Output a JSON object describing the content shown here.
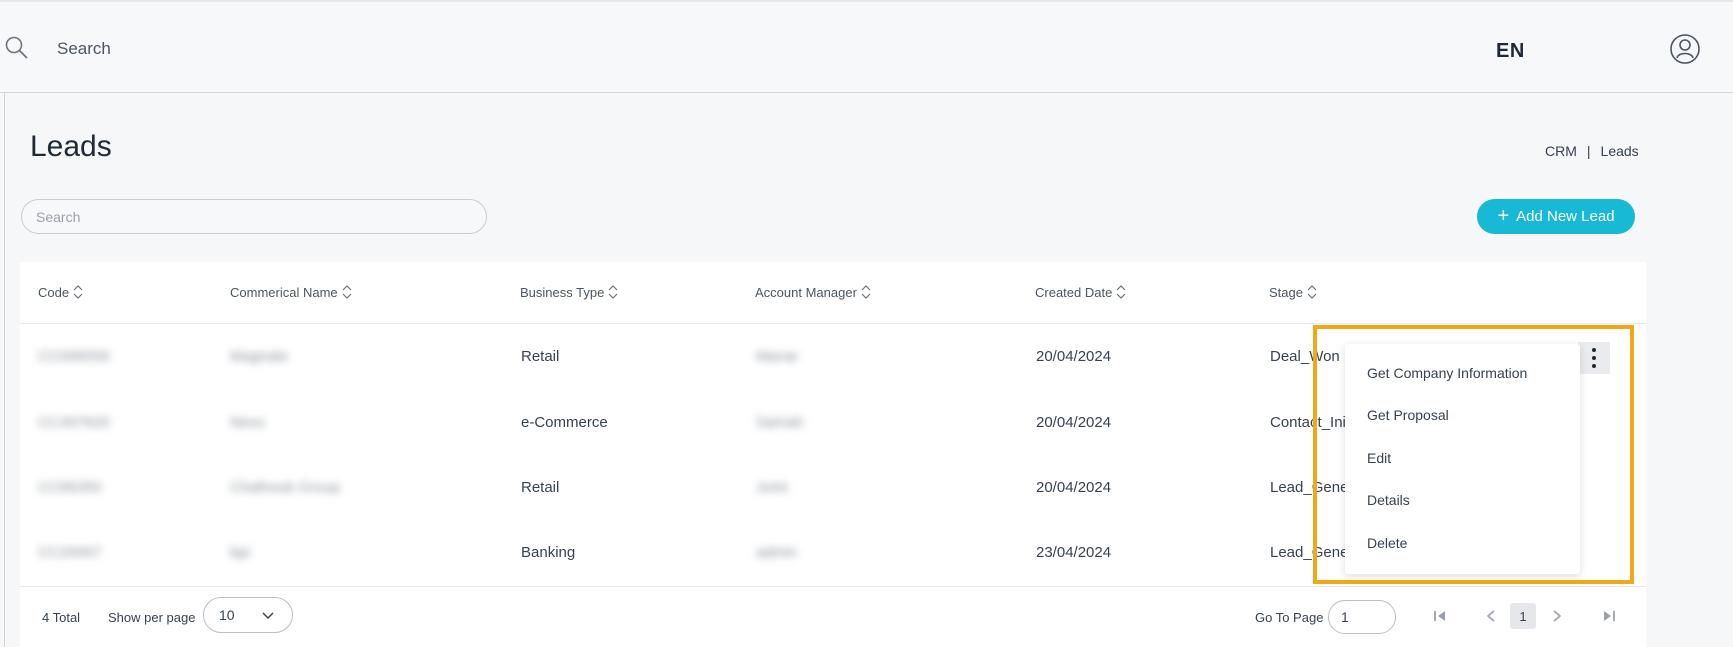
{
  "topbar": {
    "search_text": "Search",
    "language": "EN"
  },
  "page": {
    "title": "Leads",
    "breadcrumb": [
      "CRM",
      "Leads"
    ]
  },
  "toolbar": {
    "search_placeholder": "Search",
    "add_button_label": "Add New Lead"
  },
  "table": {
    "headers": [
      "Code",
      "Commerical Name",
      "Business Type",
      "Account Manager",
      "Created Date",
      "Stage"
    ],
    "rows": [
      {
        "code": "CC099556",
        "name": "Magnate",
        "business_type": "Retail",
        "manager": "Manar",
        "date": "20/04/2024",
        "stage": "Deal_Won"
      },
      {
        "code": "CC497620",
        "name": "Nexo",
        "business_type": "e-Commerce",
        "manager": "Samah",
        "date": "20/04/2024",
        "stage": "Contact_Ini"
      },
      {
        "code": "CC66350",
        "name": "Chalhoub Group",
        "business_type": "Retail",
        "manager": "Joint",
        "date": "20/04/2024",
        "stage": "Lead_Gene"
      },
      {
        "code": "CC20067",
        "name": "bpi",
        "business_type": "Banking",
        "manager": "admin",
        "date": "23/04/2024",
        "stage": "Lead_Gene"
      }
    ]
  },
  "footer": {
    "total": "4 Total",
    "per_page_label": "Show per page",
    "per_page_value": "10",
    "goto_label": "Go To Page",
    "goto_value": "1",
    "current_page": "1"
  },
  "context_menu": {
    "items": [
      "Get Company Information",
      "Get Proposal",
      "Edit",
      "Details",
      "Delete"
    ]
  },
  "colors": {
    "accent": "#17b9d4",
    "highlight": "#f0a818"
  }
}
